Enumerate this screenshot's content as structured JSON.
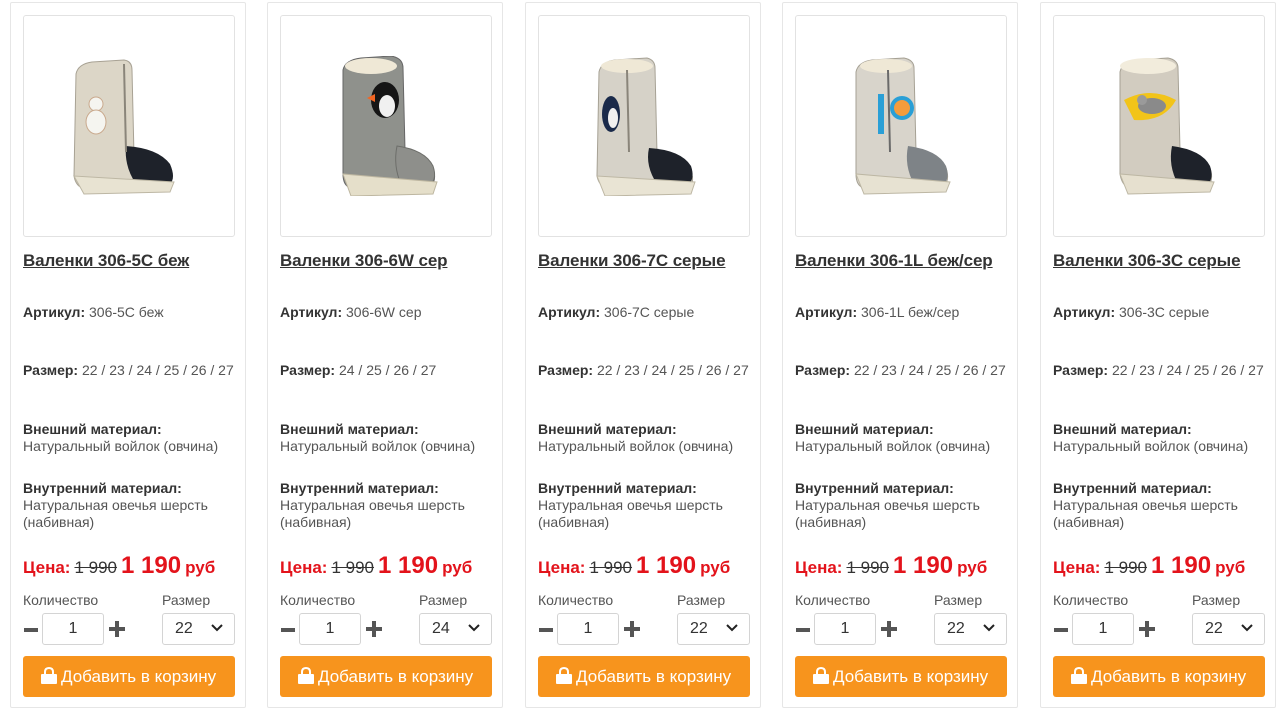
{
  "labels": {
    "article": "Артикул:",
    "size": "Размер:",
    "outer": "Внешний материал:",
    "inner": "Внутренний материал:",
    "price": "Цена:",
    "currency": "руб",
    "quantity": "Количество",
    "size_select": "Размер",
    "add_to_cart": "Добавить в корзину"
  },
  "colors": {
    "accent": "#f7941d",
    "price_red": "#e3131b",
    "felt_beige": "#dcd6c7",
    "felt_gray": "#8f918c"
  },
  "products": [
    {
      "title": "Валенки 306-5С беж",
      "article": "306-5С беж",
      "sizes": "22 / 23 / 24 / 25 / 26 / 27",
      "outer_material": "Натуральный войлок (овчина)",
      "inner_material": "Натуральная овечья шерсть (набивная)",
      "old_price": "1 990",
      "new_price": "1 190",
      "quantity": "1",
      "selected_size": "22",
      "felt_color": "#dcd6c7",
      "toe_color": "#1e222a",
      "applique": "snowman"
    },
    {
      "title": "Валенки 306-6W сер",
      "article": "306-6W сер",
      "sizes": "24 / 25 / 26 / 27",
      "outer_material": "Натуральный войлок (овчина)",
      "inner_material": "Натуральная овечья шерсть (набивная)",
      "old_price": "1 990",
      "new_price": "1 190",
      "quantity": "1",
      "selected_size": "24",
      "felt_color": "#8f918c",
      "toe_color": "#8e8f8b",
      "applique": "penguin"
    },
    {
      "title": "Валенки 306-7С серые",
      "article": "306-7С серые",
      "sizes": "22 / 23 / 24 / 25 / 26 / 27",
      "outer_material": "Натуральный войлок (овчина)",
      "inner_material": "Натуральная овечья шерсть (набивная)",
      "old_price": "1 990",
      "new_price": "1 190",
      "quantity": "1",
      "selected_size": "22",
      "felt_color": "#d6d2c8",
      "toe_color": "#1e222a",
      "applique": "penguin-side"
    },
    {
      "title": "Валенки 306-1L беж/сер",
      "article": "306-1L беж/сер",
      "sizes": "22 / 23 / 24 / 25 / 26 / 27",
      "outer_material": "Натуральный войлок (овчина)",
      "inner_material": "Натуральная овечья шерсть (набивная)",
      "old_price": "1 990",
      "new_price": "1 190",
      "quantity": "1",
      "selected_size": "22",
      "felt_color": "#d8d4cb",
      "toe_color": "#7e8387",
      "applique": "fox"
    },
    {
      "title": "Валенки 306-3С серые",
      "article": "306-3С серые",
      "sizes": "22 / 23 / 24 / 25 / 26 / 27",
      "outer_material": "Натуральный войлок (овчина)",
      "inner_material": "Натуральная овечья шерсть (набивная)",
      "old_price": "1 990",
      "new_price": "1 190",
      "quantity": "1",
      "selected_size": "22",
      "felt_color": "#d2ccc0",
      "toe_color": "#1e222a",
      "applique": "mouse"
    }
  ]
}
